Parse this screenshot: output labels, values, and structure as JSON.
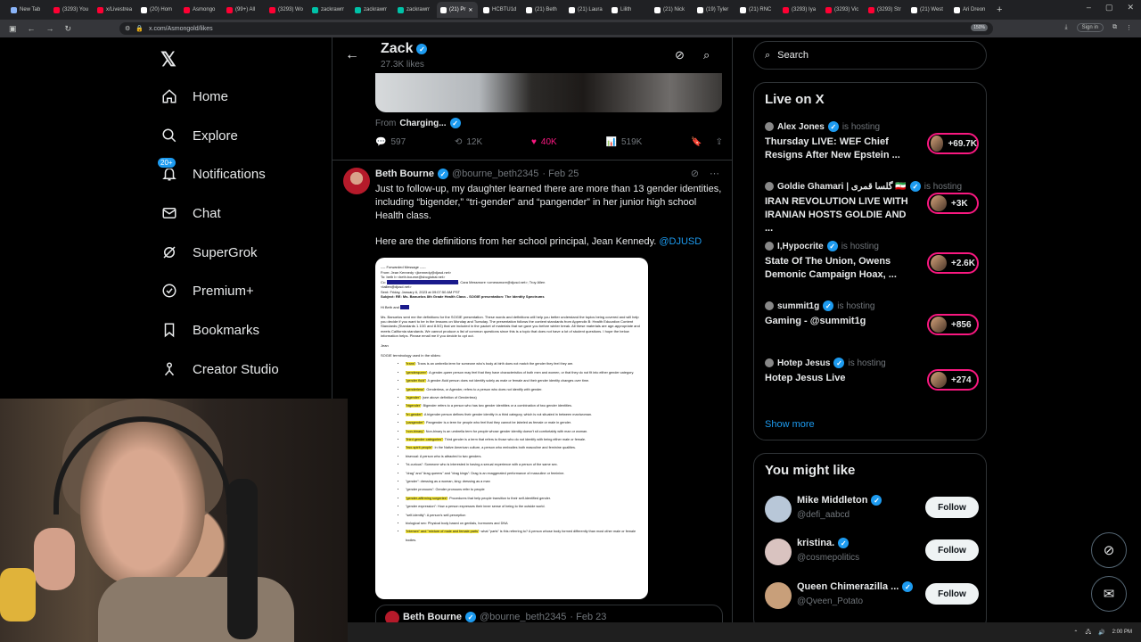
{
  "browser": {
    "tabs": [
      {
        "label": "New Tab",
        "color": "#8ab4f8"
      },
      {
        "label": "(3293) You",
        "color": "#ff0033"
      },
      {
        "label": "x/Livestrea",
        "color": "#ff0033"
      },
      {
        "label": "(20) Hom",
        "color": "#ffffff"
      },
      {
        "label": "Asmongo",
        "color": "#ff0033"
      },
      {
        "label": "(99+) All",
        "color": "#ff0033"
      },
      {
        "label": "(3293) Wo",
        "color": "#ff0033"
      },
      {
        "label": "zackrawrr",
        "color": "#00c2a8"
      },
      {
        "label": "zackrawrr",
        "color": "#00c2a8"
      },
      {
        "label": "zackrawrr",
        "color": "#00c2a8"
      },
      {
        "label": "(21) Pr",
        "color": "#ffffff",
        "active": true
      },
      {
        "label": "HCBTU1d",
        "color": "#ffffff"
      },
      {
        "label": "(21) Beth",
        "color": "#ffffff"
      },
      {
        "label": "(21) Laura",
        "color": "#ffffff"
      },
      {
        "label": "Lilith",
        "color": "#ffffff"
      },
      {
        "label": "(21) Nick",
        "color": "#ffffff"
      },
      {
        "label": "(19) Tyler",
        "color": "#ffffff"
      },
      {
        "label": "(21) RNC",
        "color": "#ffffff"
      },
      {
        "label": "(3293) Iya",
        "color": "#ff0033"
      },
      {
        "label": "(3293) Vic",
        "color": "#ff0033"
      },
      {
        "label": "(3293) Str",
        "color": "#ff0033"
      },
      {
        "label": "(21) West",
        "color": "#ffffff"
      },
      {
        "label": "Ari Dreon",
        "color": "#ffffff"
      }
    ],
    "url": "x.com/Asmongold/likes",
    "zoom": "150%",
    "signin": "Sign in"
  },
  "nav": {
    "items": [
      {
        "label": "Home"
      },
      {
        "label": "Explore"
      },
      {
        "label": "Notifications",
        "badge": "20+"
      },
      {
        "label": "Chat"
      },
      {
        "label": "SuperGrok"
      },
      {
        "label": "Premium+"
      },
      {
        "label": "Bookmarks"
      },
      {
        "label": "Creator Studio"
      }
    ]
  },
  "header": {
    "name": "Zack",
    "likes": "27.3K likes"
  },
  "prev_tweet": {
    "from_label": "From",
    "from_name": "Charging...",
    "replies": "597",
    "reposts": "12K",
    "likes": "40K",
    "views": "519K"
  },
  "tweet": {
    "name": "Beth Bourne",
    "handle": "@bourne_beth2345",
    "date": "· Feb 25",
    "text": "Just to follow-up, my daughter learned there are more than 13 gender identities, including “bigender,” “tri-gender” and “pangender” in her junior high school Health class.",
    "text2": "Here are the definitions from her school principal, Jean Kennedy.",
    "mention": "@DJUSD",
    "doc": {
      "forwarded": "---- Forwarded Message -----",
      "from": "From: Jean Kennedy <jkennedy@djusd.net>",
      "to": "To: beth b <beth.bourne@sbcglobal.net>",
      "cc": "Cc:",
      "cc_rest": "; Cara Messmore <cmessmore@djusd.net>; Troy Allen",
      "cc_rest2": "<tallen@djusd.net>",
      "sent": "Sent: Friday, January 6, 2023 at 09:07:50 AM PST",
      "subject": "Subject: RE: Ms. Banuelos 8th Grade Health Class - SOGIE presentation: The Identity Spectrums",
      "greeting": "Hi Beth and",
      "para": "Ms. Banuelos sent me the definitions for the SOGIE presentation. These words and definitions will help you better understand the topics being covered and will help you decide if you want to be in the lessons on Monday and Tuesday. The presentation follows the content standards from Appendix B: Health Education Content Standards (Standards 1.10G and 8.5G) that we included in the packet of materials that we gave you before winter break. All these materials are age-appropriate and meets California standards. We cannot produce a list of common questions since this is a topic that does not have a lot of student questions. I hope the below information helps. Please email me if you decide to opt out.",
      "sign": "Jean",
      "terms_header": "SOGIE terminology used in the slides:",
      "terms": [
        {
          "hl": "\"trans\"",
          "rest": ": Trans is an umbrella term for someone who's body at birth does not match the gender they feel they are."
        },
        {
          "hl": "\"genderqueer\"",
          "rest": ": A gender-queer person may feel that they have characteristics of both men and women, or that they do not fit into either gender category."
        },
        {
          "hl": "\"gender fluid\"",
          "rest": ": A gender-fluid person does not identify solely as male or female and their gender identity changes over time."
        },
        {
          "hl": "\"genderless\"",
          "rest": ": Genderless, or Agender, refers to a person who does not identify with gender."
        },
        {
          "hl": "\"agender\"",
          "rest": ": (see above definition of Genderless)"
        },
        {
          "hl": "\"bigender\"",
          "rest": ": Bigender refers to a person who has two gender identities or a combination of two gender identities."
        },
        {
          "hl": "\"tri-gender\"",
          "rest": ": A trigender person defines their gender identity in a third category, which is not situated in between man/woman."
        },
        {
          "hl": "\"pangender\"",
          "rest": ": Pangender is a term for people who feel that they cannot be labeled as female or male in gender."
        },
        {
          "hl": "\"non-binary\"",
          "rest": ": Non-binary is an umbrella term for people whose gender identity doesn't sit comfortably with man or woman."
        },
        {
          "hl": "\"third gender categories\"",
          "rest": ": Third gender is a term that refers to those who do not identify with being either male or female."
        },
        {
          "hl": "\"two-spirit people\"",
          "rest": ": In the Native American culture, a person who embodies both masculine and feminine qualities."
        },
        {
          "hl": "",
          "rest": "bisexual: A person who is attracted to two genders."
        },
        {
          "hl": "",
          "rest": "\"bi-curious\": Someone who is interested in having a sexual experience with a person of the same sex."
        },
        {
          "hl": "",
          "rest": "\"drag\" and \"drag queens\" and \"drag kings\": Drag is an exaggerated performance of masculine or feminine."
        },
        {
          "hl": "",
          "rest": "\"gender\": dressing as a woman, king: dressing as a man"
        },
        {
          "hl": "",
          "rest": "\"gender pronouns\": Gender pronouns refer to people"
        },
        {
          "hl": "\"gender-affirming surgeries\"",
          "rest": ": Procedures that help people transition to their self-identified gender."
        },
        {
          "hl": "",
          "rest": "\"gender expression\": How a person expresses their inner sense of being to the outside world."
        },
        {
          "hl": "",
          "rest": "\"self-identity\": A person's self-perception"
        },
        {
          "hl": "",
          "rest": "biological sex: Physical body based on genitals, hormones and DNA"
        },
        {
          "hl": "\"intersex\" and \"mixture of male and female parts\"",
          "rest": ": what \"parts\" is this referring to? A person whose body formed differently than most other male or female bodies."
        }
      ]
    }
  },
  "quote": {
    "name": "Beth Bourne",
    "handle": "@bourne_beth2345",
    "date": "· Feb 23"
  },
  "sidebar": {
    "search_placeholder": "Search",
    "live_title": "Live on X",
    "live": [
      {
        "host": "Alex Jones",
        "status": "is hosting",
        "title": "Thursday LIVE: WEF Chief Resigns After New Epstein ...",
        "count": "+69.7K"
      },
      {
        "host": "Goldie Ghamari | گلسا قمری 🇮🇷",
        "status": "is hosting",
        "title": "IRAN REVOLUTION LIVE WITH IRANIAN HOSTS GOLDIE AND ...",
        "count": "+3K"
      },
      {
        "host": "I,Hypocrite",
        "status": "is hosting",
        "title": "State Of The Union, Owens Demonic Campaign Hoax, ...",
        "count": "+2.6K"
      },
      {
        "host": "summit1g",
        "status": "is hosting",
        "title": "Gaming - @summit1g",
        "count": "+856"
      },
      {
        "host": "Hotep Jesus",
        "status": "is hosting",
        "title": "Hotep Jesus Live",
        "count": "+274"
      }
    ],
    "show_more": "Show more",
    "yml_title": "You might like",
    "yml": [
      {
        "name": "Mike Middleton",
        "handle": "@defi_aabcd",
        "follow": "Follow"
      },
      {
        "name": "kristina.",
        "handle": "@cosmepolitics",
        "follow": "Follow"
      },
      {
        "name": "Queen Chimerazilla ...",
        "handle": "@Qveen_Potato",
        "follow": "Follow"
      }
    ]
  },
  "taskbar": {
    "time": "2:00 PM"
  }
}
